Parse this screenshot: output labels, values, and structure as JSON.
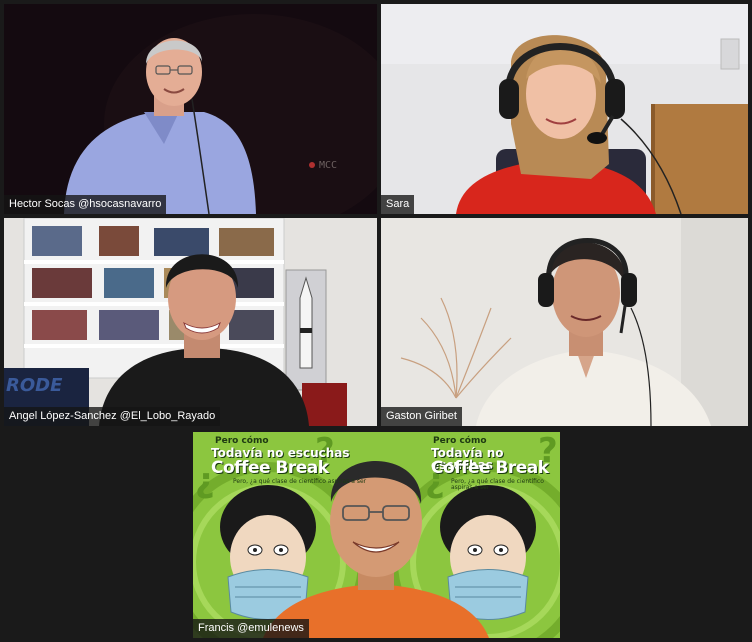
{
  "participants": [
    {
      "name": "Hector Socas @hsocasnavarro",
      "active_speaker": true
    },
    {
      "name": "Sara",
      "active_speaker": false
    },
    {
      "name": "Angel López-Sanchez @El_Lobo_Rayado",
      "active_speaker": false
    },
    {
      "name": "Gaston Giribet",
      "active_speaker": false
    },
    {
      "name": "Francis @emulenews",
      "active_speaker": false
    }
  ],
  "background_text": {
    "line1": "Pero cómo",
    "line2": "Todavía no escuchas",
    "line3": "Coffee Break",
    "tagline": "Pero, ¿a qué clase de científico aspiras a ser",
    "room_banner": "RODE",
    "screen_logo": "MCC"
  },
  "colors": {
    "active_speaker_border": "#cde86a",
    "background_green": "#8cc63f",
    "sara_shirt": "#d8261c",
    "francis_shirt": "#e8702a"
  }
}
